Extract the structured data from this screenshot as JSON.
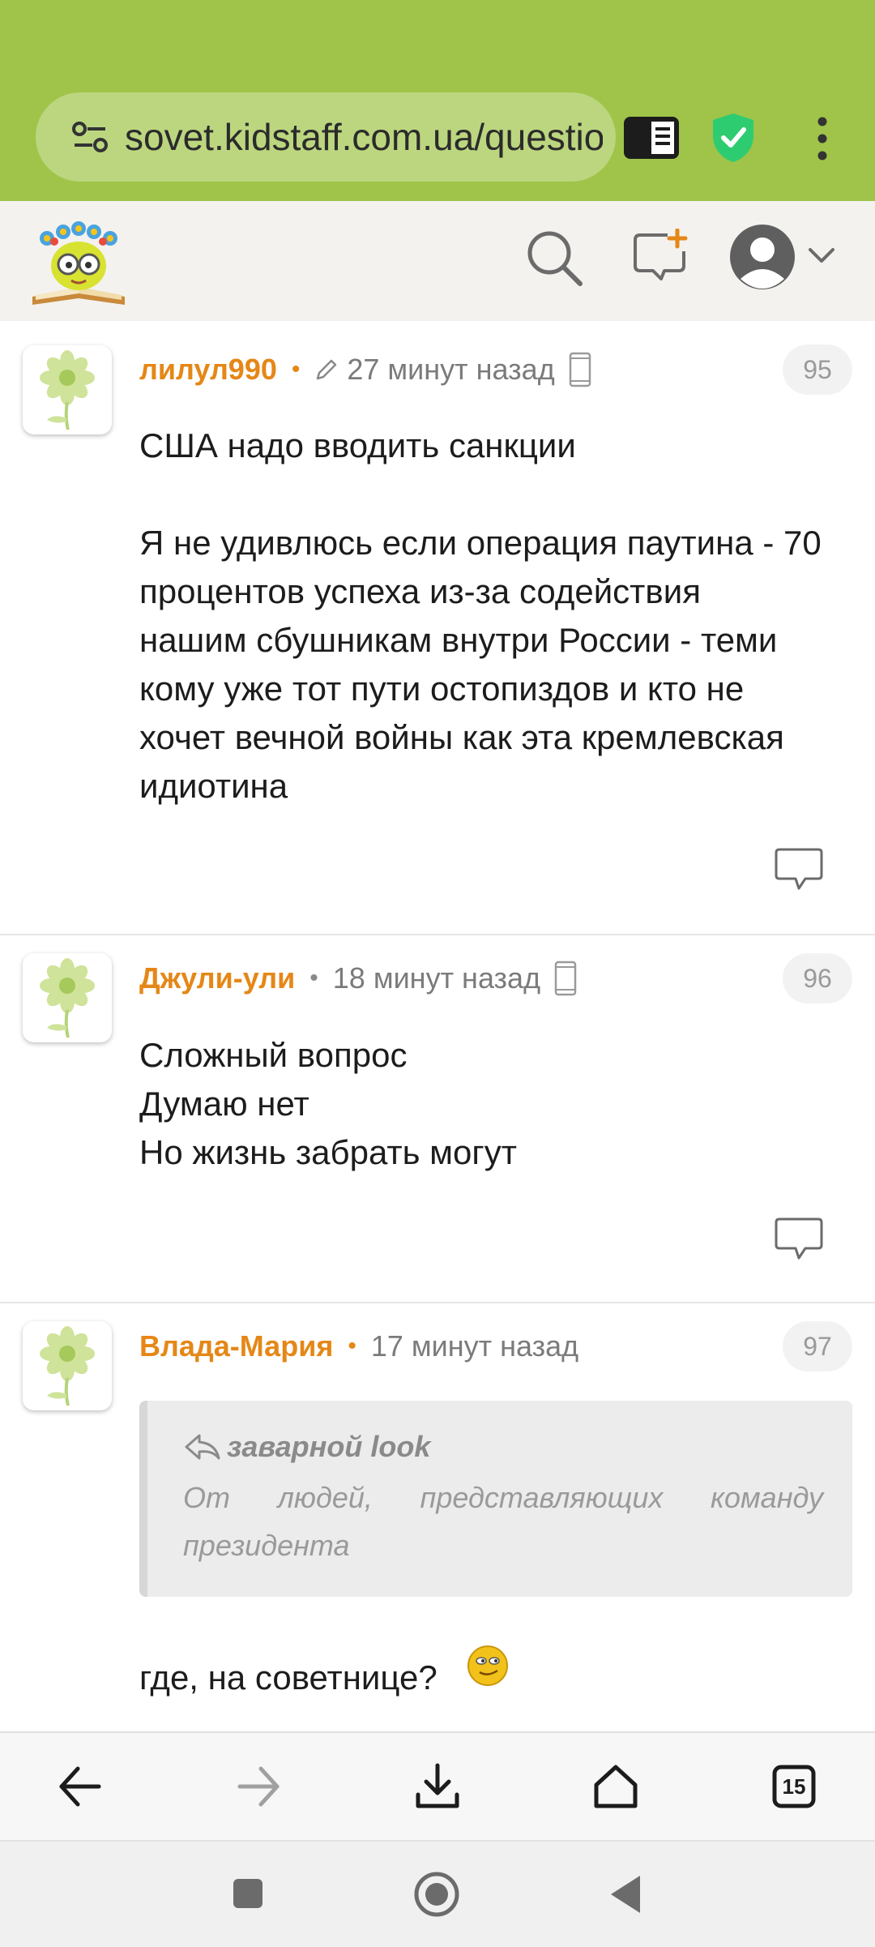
{
  "browser": {
    "url": "sovet.kidstaff.com.ua/questio",
    "tab_count": "15",
    "colors": {
      "toolbar": "#9fc449",
      "url_pill": "#bcd67f",
      "shield": "#2ecc71"
    }
  },
  "site": {
    "colors": {
      "accent": "#e58717",
      "header_bg": "#f3f2ee"
    }
  },
  "comments": [
    {
      "author": "лилул990",
      "edited": true,
      "time": "27 минут назад",
      "mobile": true,
      "number": "95",
      "lines": [
        "США надо вводить санкции",
        "",
        "Я не удивлюсь если операция паутина - 70",
        "процентов успеха из-за содействия",
        "нашим сбушникам внутри России - теми",
        "кому уже тот пути остопиздов и кто не",
        "хочет вечной войны как эта кремлевская",
        "идиотина"
      ]
    },
    {
      "author": "Джули-ули",
      "edited": false,
      "time": "18 минут назад",
      "mobile": true,
      "number": "96",
      "lines": [
        "Сложный вопрос",
        "Думаю нет",
        "Но жизнь забрать могут"
      ]
    },
    {
      "author": "Влада-Мария",
      "edited": false,
      "time": "17 минут назад",
      "mobile": false,
      "number": "97",
      "quote": {
        "author": "заварной look",
        "text": "От людей, представляющих команду президента"
      },
      "text": "где, на советнице?",
      "emoji": "smiley-icon"
    }
  ],
  "icons": {
    "url_settings": "tune-icon",
    "reader": "reader-mode-icon",
    "shield": "shield-check-icon",
    "menu": "more-vert-icon",
    "search": "search-icon",
    "new_message": "add-chat-icon",
    "user": "user-avatar-icon",
    "back": "back-arrow-icon",
    "forward": "forward-arrow-icon",
    "download": "download-icon",
    "home": "home-icon",
    "tabs": "tabs-icon"
  }
}
